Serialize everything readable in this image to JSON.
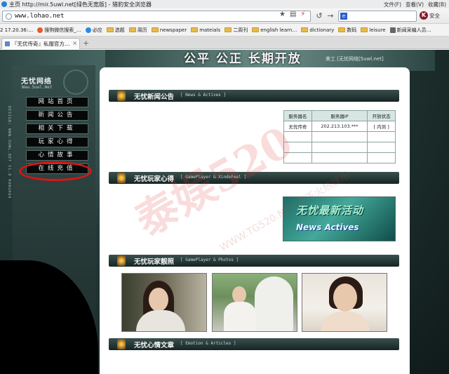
{
  "window": {
    "title": "主页 http://mir.5uwl.net[绿色无宽版] - 猎豹安全浏览器",
    "menus": [
      "文件(F)",
      "查看(V)",
      "收藏(B)"
    ]
  },
  "addressbar": {
    "url": "www.lohao.net"
  },
  "toolbar": {
    "user_initial": "K",
    "safe_label": "安全"
  },
  "bookmarks": [
    {
      "label": "2 17.20.36:…",
      "icon": "none"
    },
    {
      "label": "搜狗微信搜索_…",
      "icon": "red-dot-icon"
    },
    {
      "label": "必应",
      "icon": "blue-dot-icon"
    },
    {
      "label": "选题",
      "icon": "folder-icon"
    },
    {
      "label": "周历",
      "icon": "folder-icon"
    },
    {
      "label": "newspaper",
      "icon": "folder-icon"
    },
    {
      "label": "mateials",
      "icon": "folder-icon"
    },
    {
      "label": "二周刊",
      "icon": "folder-icon"
    },
    {
      "label": "english learn…",
      "icon": "folder-icon"
    },
    {
      "label": "dictionary",
      "icon": "folder-icon"
    },
    {
      "label": "数码",
      "icon": "folder-icon"
    },
    {
      "label": "leisure",
      "icon": "folder-icon"
    },
    {
      "label": "新闻采编人员…",
      "icon": "doc-icon"
    }
  ],
  "tab": {
    "label": "『无优传奇』私服官方…",
    "new_tab": "+"
  },
  "site": {
    "slogan": "公平 公正 长期开放",
    "slogan_small": "美工 [无忧网络[5uwl.net]",
    "logo_title": "无忧网络",
    "logo_sub": "Www.5uwl.Net",
    "vertical_text": "DESIGN: WWW.5UWL.NET V1.0 HONGHUA",
    "menu": [
      "网站首页",
      "新闻公告",
      "相关下载",
      "玩家心得",
      "心情故事",
      "在线充值"
    ],
    "sections": [
      {
        "title": "无忧新闻公告",
        "sub": "[ News & Actives ]"
      },
      {
        "title": "无忧玩家心得",
        "sub": "[ GamePlayer & XindeFeel ]"
      },
      {
        "title": "无忧玩家靓照",
        "sub": "[ GamePlayer & Photos ]"
      },
      {
        "title": "无忧心情文章",
        "sub": "[ Emotion & Articles ]"
      }
    ],
    "server_table": {
      "headers": [
        "服务器名",
        "服务器IP",
        "开放状态"
      ],
      "rows": [
        [
          "无忧传奇",
          "202.213.103.***",
          "[ 内测 ]"
        ],
        [
          "",
          "",
          ""
        ],
        [
          "",
          "",
          ""
        ],
        [
          "",
          "",
          ""
        ]
      ]
    },
    "news_banner": {
      "title": "无忧最新活动",
      "en": "News Actives"
    },
    "watermark": "泰娱520",
    "watermark_sub": "WWW.TG520.NET 天下火热娱乐"
  },
  "colors": {
    "highlight": "#d91515",
    "section_bar": "#1f3533"
  }
}
